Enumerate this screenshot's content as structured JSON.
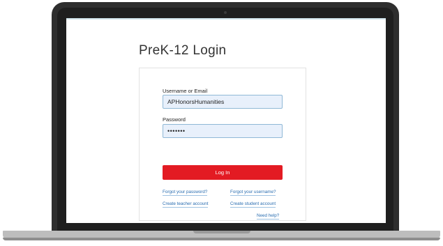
{
  "page": {
    "title": "PreK-12 Login"
  },
  "form": {
    "username_label": "Username or Email",
    "username_value": "APHonorsHumanities",
    "password_label": "Password",
    "password_value": "•••••••",
    "login_button": "Log In"
  },
  "links": {
    "forgot_password": "Forgot your password?",
    "forgot_username": "Forgot your username?",
    "create_teacher": "Create teacher account",
    "create_student": "Create student account",
    "need_help": "Need help?"
  },
  "colors": {
    "accent_button": "#e31b23",
    "link": "#2a6db0",
    "input_background": "#e8f0fb"
  }
}
